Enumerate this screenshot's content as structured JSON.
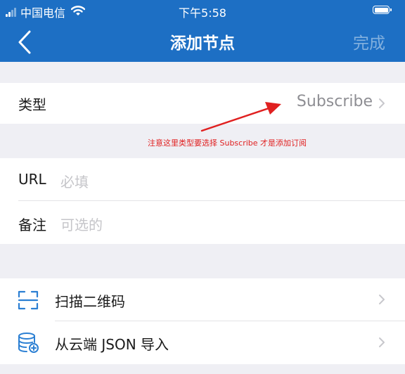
{
  "status_bar": {
    "carrier": "中国电信",
    "time": "下午5:58"
  },
  "nav": {
    "title": "添加节点",
    "done_label": "完成"
  },
  "type_row": {
    "label": "类型",
    "value": "Subscribe"
  },
  "annotation": "注意这里类型要选择 Subscribe 才是添加订阅",
  "url_row": {
    "label": "URL",
    "placeholder": "必填"
  },
  "note_row": {
    "label": "备注",
    "placeholder": "可选的"
  },
  "actions": [
    {
      "label": "扫描二维码",
      "icon": "qr-scan-icon"
    },
    {
      "label": "从云端 JSON 导入",
      "icon": "cloud-database-icon"
    }
  ],
  "colors": {
    "header": "#1d6fc4",
    "annotation": "#e02020",
    "background": "#efeff4"
  }
}
